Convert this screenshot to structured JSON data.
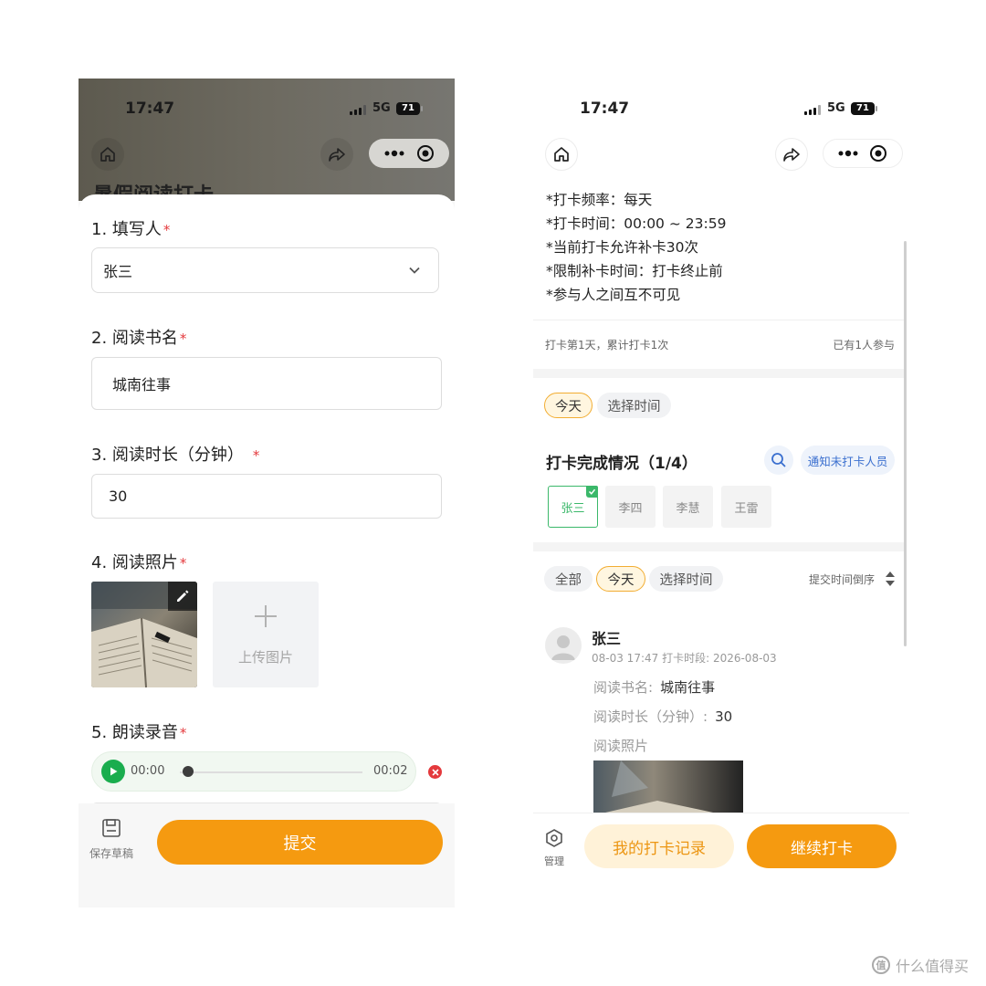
{
  "left": {
    "status": {
      "time": "17:47",
      "network": "5G",
      "battery": "71"
    },
    "header_title": "暑假阅读打卡",
    "questions": [
      {
        "number_label": "1. 填写人",
        "required": "*",
        "value": "张三"
      },
      {
        "number_label": "2. 阅读书名",
        "required": "*",
        "value": "城南往事"
      },
      {
        "number_label": "3. 阅读时长（分钟）",
        "required": "*",
        "value": "30"
      },
      {
        "number_label": "4. 阅读照片",
        "required": "*"
      },
      {
        "number_label": "5. 朗读录音",
        "required": "*"
      }
    ],
    "upload_label": "上传图片",
    "audio": {
      "current": "00:00",
      "duration": "00:02",
      "progress": 0
    },
    "footer": {
      "draft_label": "保存草稿",
      "submit_label": "提交"
    }
  },
  "right": {
    "status": {
      "time": "17:47",
      "network": "5G",
      "battery": "71"
    },
    "rules": [
      "*打卡频率：每天",
      "*打卡时间：00:00 ~ 23:59",
      "*当前打卡允许补卡30次",
      "*限制补卡时间：打卡终止前",
      "*参与人之间互不可见"
    ],
    "summary_left": "打卡第1天，累计打卡1次",
    "summary_right": "已有1人参与",
    "filter_top": {
      "today": "今天",
      "pick_time": "选择时间"
    },
    "completion_title": "打卡完成情况（1/4）",
    "notify_label": "通知未打卡人员",
    "members": [
      {
        "name": "张三",
        "done": true
      },
      {
        "name": "李四",
        "done": false
      },
      {
        "name": "李慧",
        "done": false
      },
      {
        "name": "王雷",
        "done": false
      }
    ],
    "filter_list": {
      "all": "全部",
      "today": "今天",
      "pick_time": "选择时间",
      "sort": "提交时间倒序"
    },
    "post": {
      "user": "张三",
      "meta": "08-03 17:47 打卡时段: 2026-08-03",
      "book_label": "阅读书名:",
      "book_value": "城南往事",
      "duration_label": "阅读时长（分钟）:",
      "duration_value": "30",
      "photo_label": "阅读照片"
    },
    "footer": {
      "manage_label": "管理",
      "my_records": "我的打卡记录",
      "continue": "继续打卡"
    }
  },
  "watermark": "什么值得买",
  "colors": {
    "accent": "#f59a10",
    "required": "#e4393c",
    "success": "#3bb86a",
    "link": "#3a6fcf"
  }
}
